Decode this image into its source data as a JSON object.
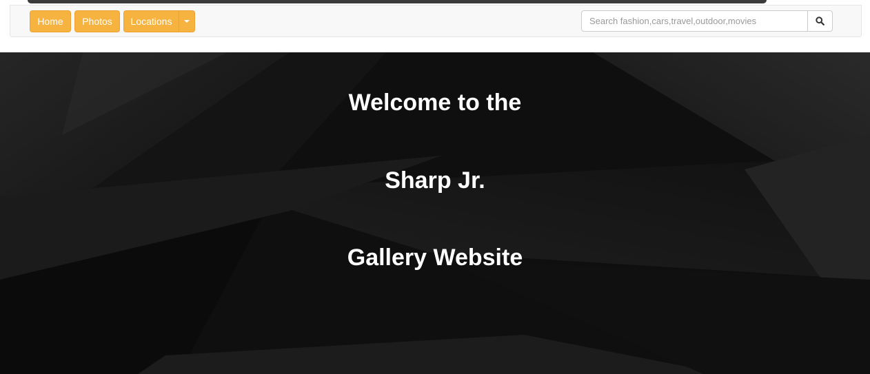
{
  "navbar": {
    "buttons": [
      {
        "label": "Home"
      },
      {
        "label": "Photos"
      },
      {
        "label": "Locations"
      }
    ],
    "dropdown_icon": "caret-down-icon",
    "search": {
      "placeholder": "Search fashion,cars,travel,outdoor,movies",
      "value": "",
      "button_icon": "search-icon"
    }
  },
  "hero": {
    "lines": [
      "Welcome to the",
      "Sharp Jr.",
      "Gallery Website"
    ]
  },
  "colors": {
    "button": "#f7b33f",
    "navbar_bg": "#f8f8f8",
    "hero_bg": "#0d0d0d",
    "hero_text": "#ffffff"
  }
}
